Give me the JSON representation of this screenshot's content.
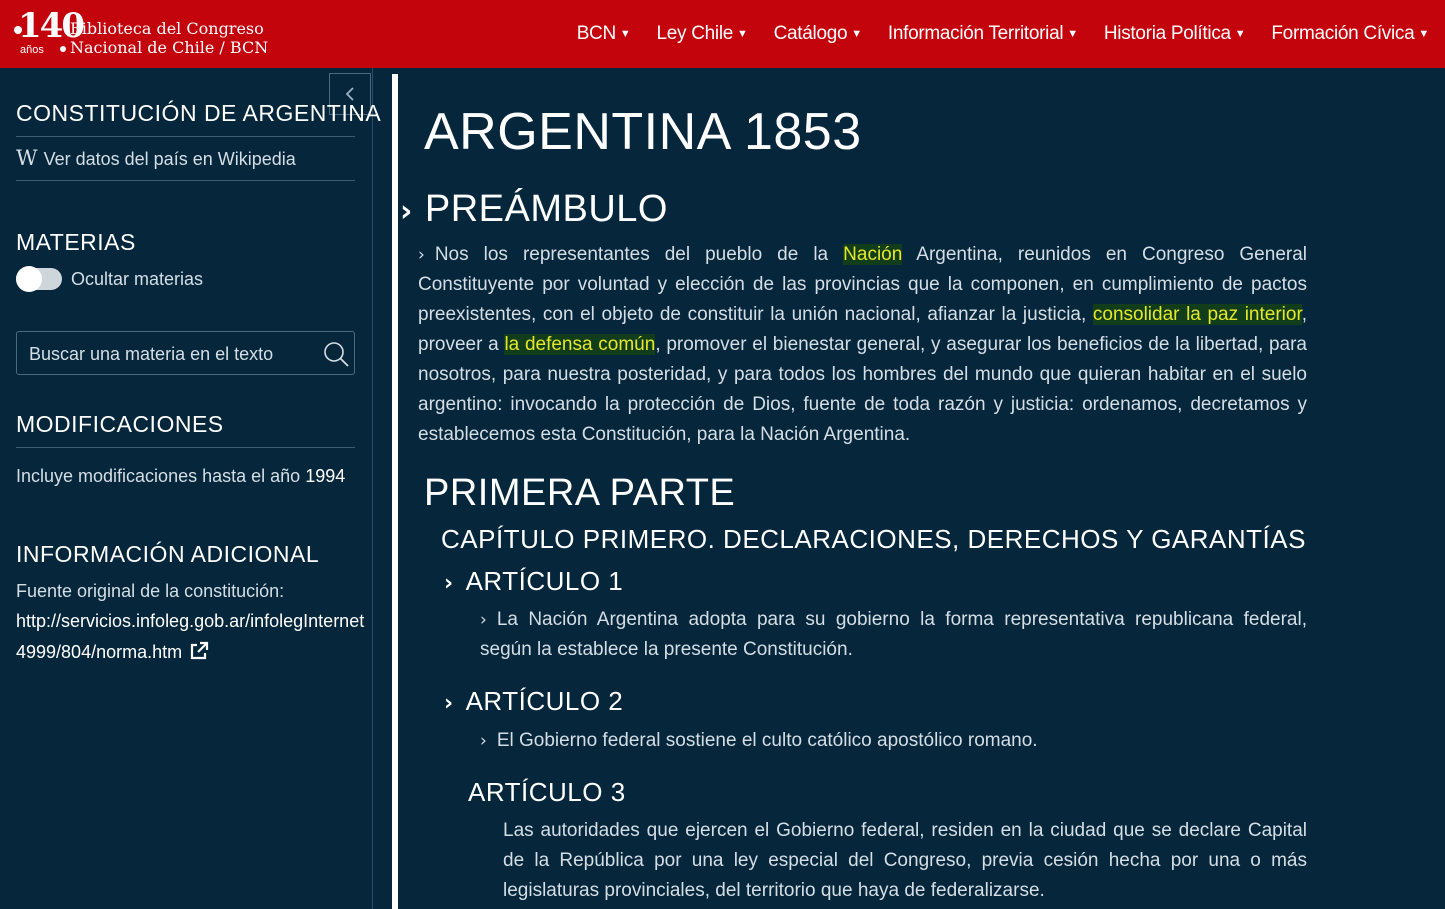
{
  "header": {
    "logo_number": "140",
    "logo_years": "años",
    "logo_line1": "Biblioteca del Congreso",
    "logo_line2": "Nacional de Chile / BCN",
    "nav": [
      {
        "label": "BCN"
      },
      {
        "label": "Ley Chile"
      },
      {
        "label": "Catálogo"
      },
      {
        "label": "Información Territorial"
      },
      {
        "label": "Historia Política"
      },
      {
        "label": "Formación Cívica"
      }
    ]
  },
  "sidebar": {
    "collapse_icon": "chevron-left-icon",
    "constitution_title": "CONSTITUCIÓN DE ARGENTINA",
    "wikipedia_w": "W",
    "wikipedia_link": "Ver datos del país en Wikipedia",
    "materias_title": "MATERIAS",
    "toggle_label": "Ocultar materias",
    "toggle_on": false,
    "search_placeholder": "Buscar una materia en el texto",
    "modificaciones_title": "MODIFICACIONES",
    "modificaciones_text": "Incluye modificaciones hasta el año",
    "modificaciones_year": "1994",
    "info_title": "INFORMACIÓN ADICIONAL",
    "info_source_label": "Fuente original de la constitución:",
    "info_url_line1": "http://servicios.infoleg.gob.ar/infolegInternet",
    "info_url_line2": "4999/804/norma.htm"
  },
  "main": {
    "title": "ARGENTINA 1853",
    "preambulo_title": "PREÁMBULO",
    "preambulo": {
      "p1": "Nos los representantes del pueblo de la ",
      "h1": "Nación",
      "p2": " Argentina, reunidos en Congreso General Constituyente por voluntad y elección de las provincias que la componen, en cumplimiento de pactos preexistentes, con el objeto de constituir la unión nacional, afianzar la justicia, ",
      "h2": "consolidar la paz interior",
      "p3": ", proveer a ",
      "h3": "la defensa común",
      "p4": ", promover el bienestar general, y asegurar los beneficios de la libertad, para nosotros, para nuestra posteridad, y para todos los hombres del mundo que quieran habitar en el suelo argentino: invocando la protección de Dios, fuente de toda razón y justicia: ordenamos, decretamos y establecemos esta Constitución, para la Nación Argentina."
    },
    "part_title": "PRIMERA PARTE",
    "chapter_title": "CAPÍTULO PRIMERO. DECLARACIONES, DERECHOS Y GARANTÍAS",
    "articles": [
      {
        "title": "ARTÍCULO 1",
        "text": "La Nación Argentina adopta para su gobierno la forma representativa republicana federal, según la establece la presente Constitución."
      },
      {
        "title": "ARTÍCULO 2",
        "text": "El Gobierno federal sostiene el culto católico apostólico romano."
      },
      {
        "title": "ARTÍCULO 3",
        "text": "Las autoridades que ejercen el Gobierno federal, residen en la ciudad que se declare Capital de la República por una ley especial del Congreso, previa cesión hecha por una o más legislaturas provinciales, del territorio que haya de federalizarse."
      }
    ]
  }
}
